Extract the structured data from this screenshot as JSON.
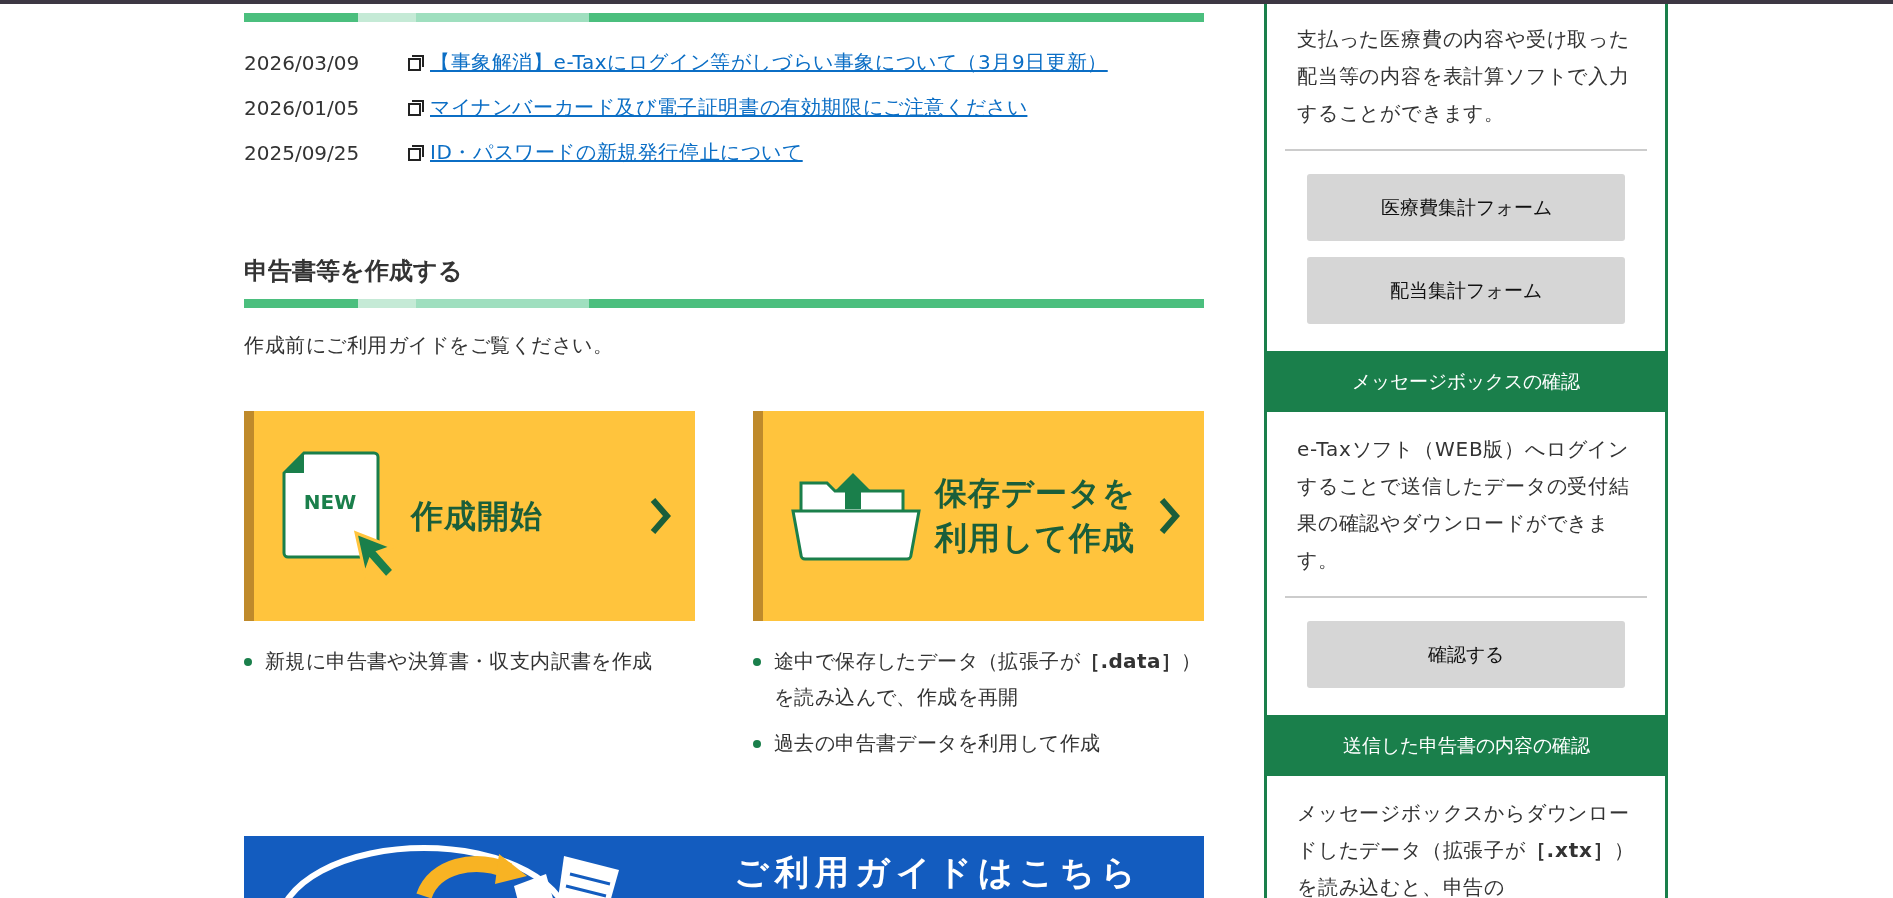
{
  "news": [
    {
      "date": "2026/03/09",
      "title": "【事象解消】e-Taxにログイン等がしづらい事象について（3月9日更新）"
    },
    {
      "date": "2026/01/05",
      "title": "マイナンバーカード及び電子証明書の有効期限にご注意ください"
    },
    {
      "date": "2025/09/25",
      "title": "ID・パスワードの新規発行停止について"
    }
  ],
  "section": {
    "title": "申告書等を作成する",
    "intro": "作成前にご利用ガイドをご覧ください。",
    "cards": [
      {
        "kind": "new",
        "badge": "NEW",
        "label": [
          "作成開始"
        ],
        "notes": [
          "新規に申告書や決算書・収支内訳書を作成"
        ]
      },
      {
        "kind": "folder",
        "label": [
          "保存データを",
          "利用して作成"
        ],
        "notes": [
          "途中で保存したデータ（拡張子が**［.data］**）を読み込んで、作成を再開",
          "過去の申告書データを利用して作成"
        ]
      }
    ],
    "banner": "ご利用ガイドはこちら"
  },
  "sidebar": [
    {
      "text": "支払った医療費の内容や受け取った配当等の内容を表計算ソフトで入力することができます。",
      "buttons": [
        "医療費集計フォーム",
        "配当集計フォーム"
      ]
    },
    {
      "heading": "メッセージボックスの確認",
      "text": "e-Taxソフト（WEB版）へログインすることで送信したデータの受付結果の確認やダウンロードができます。",
      "buttons": [
        "確認する"
      ]
    },
    {
      "heading": "送信した申告書の内容の確認",
      "text": "メッセージボックスからダウンロードしたデータ（拡張子が**［.xtx］**）を読み込むと、申告の"
    }
  ]
}
